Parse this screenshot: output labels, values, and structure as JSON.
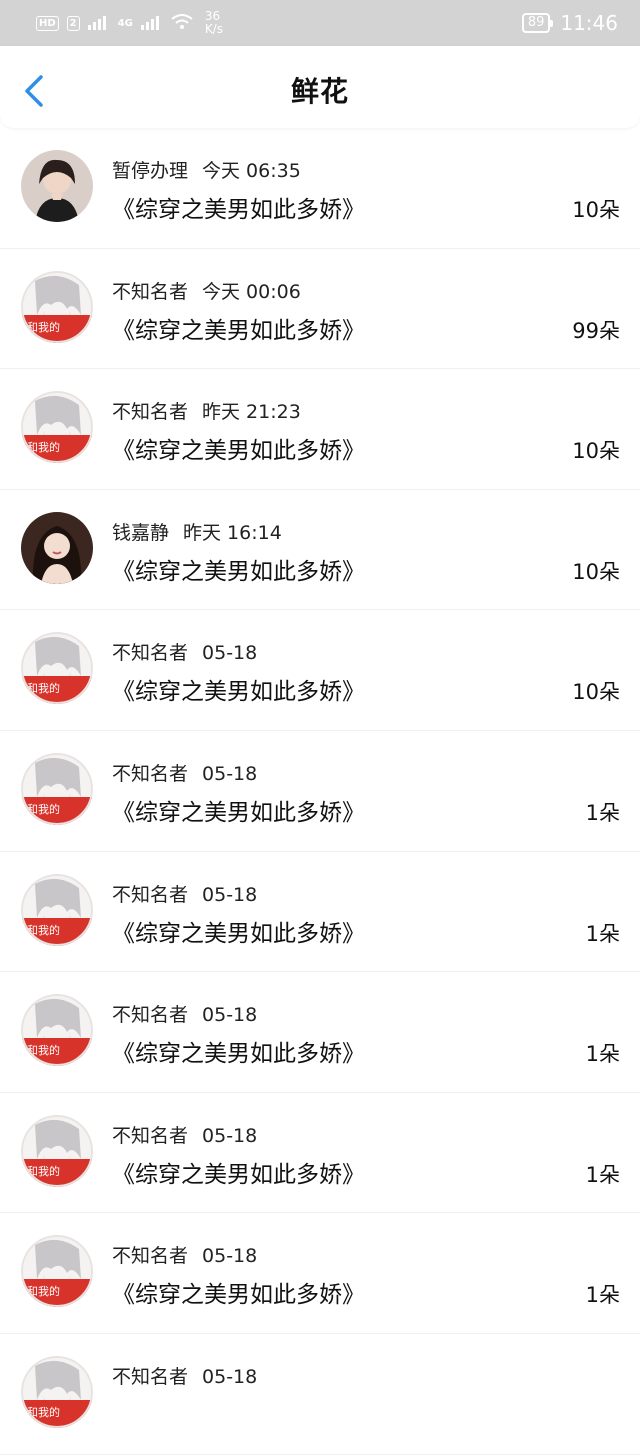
{
  "status_bar": {
    "hd_label": "HD",
    "sim_label": "2",
    "net_type": "4G",
    "speed_value": "36",
    "speed_unit": "K/s",
    "battery": "89",
    "time": "11:46"
  },
  "header": {
    "title": "鲜花",
    "back_icon": "chevron-left-icon"
  },
  "accent_color": "#2f8fe8",
  "rows": [
    {
      "name": "暂停办理",
      "time": "今天 06:35",
      "book": "《综穿之美男如此多娇》",
      "count": "10朵",
      "avatar": "girl-photo"
    },
    {
      "name": "不知名者",
      "time": "今天 00:06",
      "book": "《综穿之美男如此多娇》",
      "count": "99朵",
      "avatar": "anime-default"
    },
    {
      "name": "不知名者",
      "time": "昨天 21:23",
      "book": "《综穿之美男如此多娇》",
      "count": "10朵",
      "avatar": "anime-default"
    },
    {
      "name": "钱嘉静",
      "time": "昨天 16:14",
      "book": "《综穿之美男如此多娇》",
      "count": "10朵",
      "avatar": "girl-photo-2"
    },
    {
      "name": "不知名者",
      "time": "05-18",
      "book": "《综穿之美男如此多娇》",
      "count": "10朵",
      "avatar": "anime-default"
    },
    {
      "name": "不知名者",
      "time": "05-18",
      "book": "《综穿之美男如此多娇》",
      "count": "1朵",
      "avatar": "anime-default"
    },
    {
      "name": "不知名者",
      "time": "05-18",
      "book": "《综穿之美男如此多娇》",
      "count": "1朵",
      "avatar": "anime-default"
    },
    {
      "name": "不知名者",
      "time": "05-18",
      "book": "《综穿之美男如此多娇》",
      "count": "1朵",
      "avatar": "anime-default"
    },
    {
      "name": "不知名者",
      "time": "05-18",
      "book": "《综穿之美男如此多娇》",
      "count": "1朵",
      "avatar": "anime-default"
    },
    {
      "name": "不知名者",
      "time": "05-18",
      "book": "《综穿之美男如此多娇》",
      "count": "1朵",
      "avatar": "anime-default"
    },
    {
      "name": "不知名者",
      "time": "05-18",
      "book": "",
      "count": "",
      "avatar": "anime-default"
    }
  ]
}
